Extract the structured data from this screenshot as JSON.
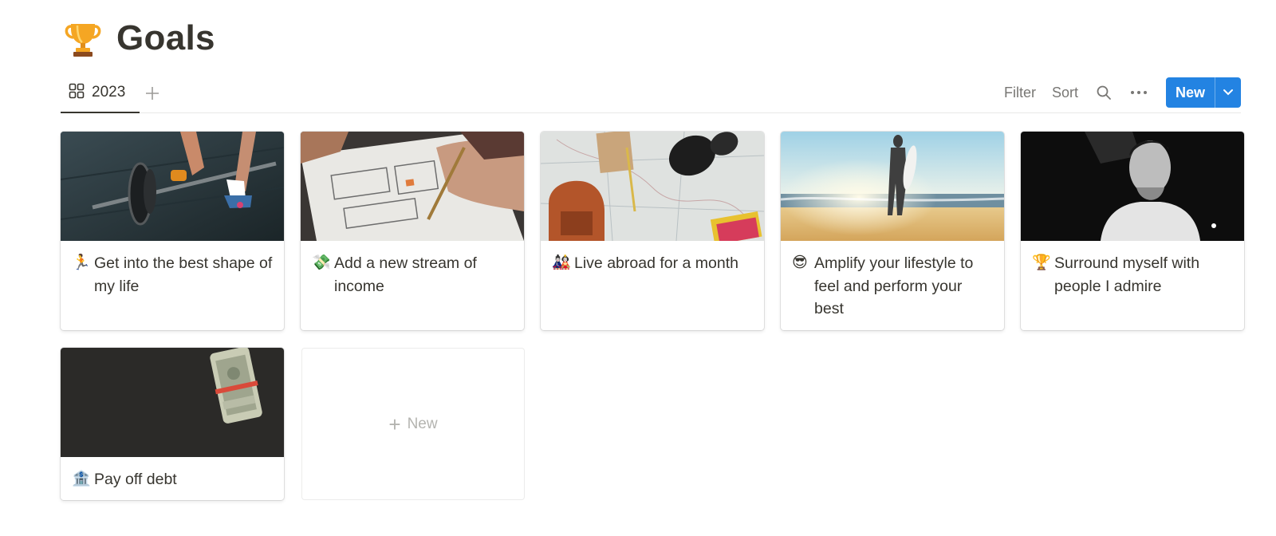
{
  "page": {
    "title": "Goals",
    "icon": "trophy-icon"
  },
  "views": {
    "active_tab": "2023",
    "tab_icon": "gallery-icon",
    "add_view_label": "+"
  },
  "toolbar": {
    "filter_label": "Filter",
    "sort_label": "Sort",
    "new_label": "New",
    "accent_color": "#2383e2"
  },
  "cards": [
    {
      "emoji": "🏃",
      "title": "Get into the best shape of my life",
      "cover": "barbell-gym-photo"
    },
    {
      "emoji": "💸",
      "title": "Add a new stream of income",
      "cover": "sketching-wireframes-photo"
    },
    {
      "emoji": "🎎",
      "title": "Live abroad for a month",
      "cover": "travel-map-photo"
    },
    {
      "emoji": "😎",
      "title": "Amplify your lifestyle to feel and perform your best",
      "cover": "surfer-sunset-photo"
    },
    {
      "emoji": "🏆",
      "title": "Surround myself with people I admire",
      "cover": "portrait-man-photo"
    },
    {
      "emoji": "🏦",
      "title": "Pay off debt",
      "cover": "cash-roll-photo"
    }
  ],
  "new_card": {
    "label": "New"
  }
}
